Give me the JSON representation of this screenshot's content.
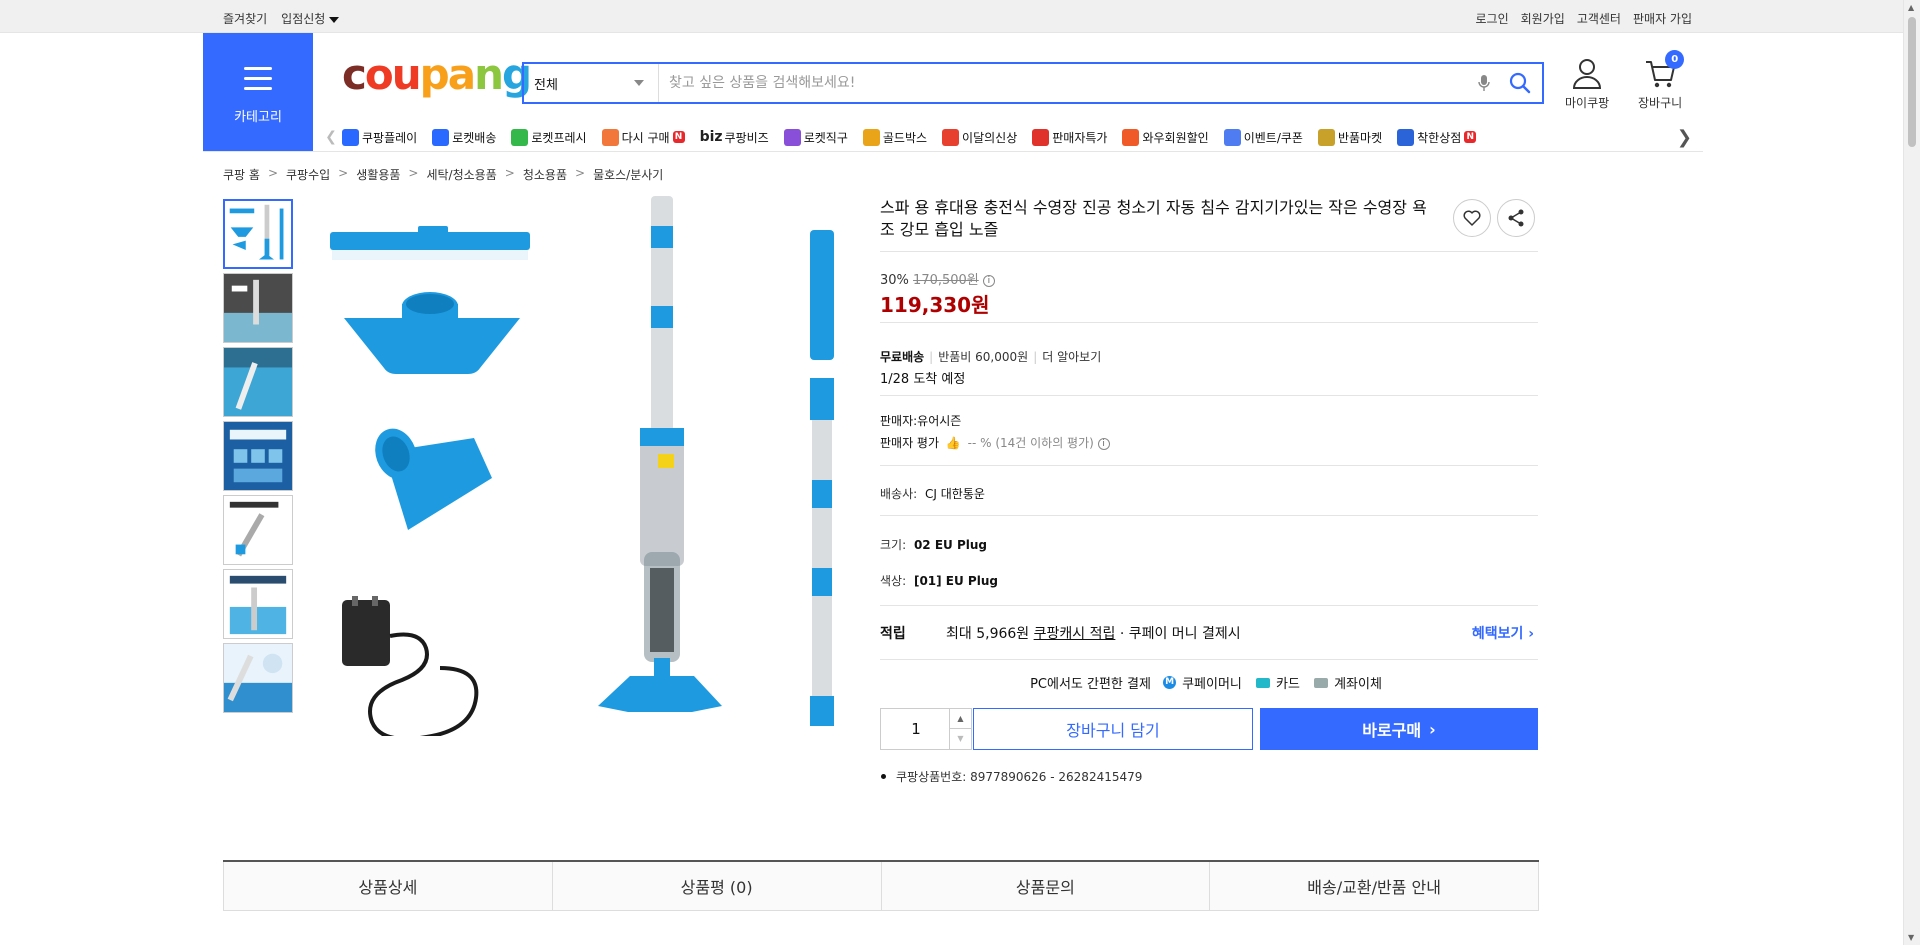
{
  "topbar": {
    "left": [
      {
        "label": "즐겨찾기"
      },
      {
        "label": "입점신청"
      }
    ],
    "right": [
      {
        "label": "로그인"
      },
      {
        "label": "회원가입"
      },
      {
        "label": "고객센터"
      },
      {
        "label": "판매자 가입"
      }
    ]
  },
  "header": {
    "category_label": "카테고리",
    "logo_text": [
      "c",
      "ou",
      "pa",
      "n",
      "g"
    ],
    "search_scope": "전체",
    "search_placeholder": "찾고 싶은 상품을 검색해보세요!",
    "mycoupang_label": "마이쿠팡",
    "cart_label": "장바구니",
    "cart_count": "0"
  },
  "shortcuts": [
    {
      "label": "쿠팡플레이",
      "icon": "play-icon",
      "color": "#2a69ff"
    },
    {
      "label": "로켓배송",
      "icon": "rocket-icon",
      "color": "#2a69ff"
    },
    {
      "label": "로켓프레시",
      "icon": "rocket-fresh-icon",
      "color": "#35b84a"
    },
    {
      "label": "다시 구매",
      "icon": "rebuy-icon",
      "color": "#f2773a",
      "new": "N"
    },
    {
      "label": "쿠팡비즈",
      "prefix": "biz",
      "icon": "biz-icon"
    },
    {
      "label": "로켓직구",
      "icon": "global-rocket-icon",
      "color": "#8a4fd8"
    },
    {
      "label": "골드박스",
      "icon": "goldbox-icon",
      "color": "#e9a41a"
    },
    {
      "label": "이달의신상",
      "icon": "new-arrival-icon",
      "color": "#e8402e"
    },
    {
      "label": "판매자특가",
      "icon": "seller-deal-icon",
      "color": "#e0322a"
    },
    {
      "label": "와우회원할인",
      "icon": "wow-icon",
      "color": "#f05a28"
    },
    {
      "label": "이벤트/쿠폰",
      "icon": "coupon-icon",
      "color": "#4f7cf0"
    },
    {
      "label": "반품마켓",
      "icon": "return-market-icon",
      "color": "#c8a12a"
    },
    {
      "label": "착한상점",
      "icon": "good-store-icon",
      "color": "#2a64d8",
      "new": "N"
    }
  ],
  "breadcrumb": [
    "쿠팡 홈",
    "쿠팡수입",
    "생활용품",
    "세탁/청소용품",
    "청소용품",
    "물호스/분사기"
  ],
  "product": {
    "title": "스파 용 휴대용 충전식 수영장 진공 청소기 자동 침수 감지기가있는 작은 수영장 욕조 강모 흡입 노즐",
    "discount_rate": "30%",
    "original_price": "170,500원",
    "price": "119,330원",
    "shipping_label": "무료배송",
    "return_fee": "반품비 60,000원",
    "learn_more": "더 알아보기",
    "arrival": "1/28 도착 예정",
    "seller": "판매자:유어시즌",
    "seller_rating_label": "판매자 평가",
    "seller_rating_value": "-- % (14건 이하의 평가)",
    "courier_label": "배송사:",
    "courier": "CJ 대한통운",
    "size_label": "크기:",
    "size": "02 EU Plug",
    "color_label": "색상:",
    "color": "[01] EU Plug",
    "reward_label": "적립",
    "reward_text_1": "최대 5,966원",
    "reward_text_2": "쿠팡캐시 적립",
    "reward_text_3": "· 쿠페이 머니 결제시",
    "reward_link": "혜택보기",
    "pay_intro": "PC에서도 간편한 결제",
    "pay_methods": [
      {
        "label": "쿠페이머니"
      },
      {
        "label": "카드"
      },
      {
        "label": "계좌이체"
      }
    ],
    "quantity": "1",
    "add_to_cart": "장바구니 담기",
    "buy_now": "바로구매",
    "product_number": "쿠팡상품번호: 8977890626 - 26282415479"
  },
  "tabs": [
    {
      "label": "상품상세"
    },
    {
      "label": "상품평 (0)"
    },
    {
      "label": "상품문의"
    },
    {
      "label": "배송/교환/반품 안내"
    }
  ],
  "colors": {
    "accent": "#346aff",
    "price": "#ae0000"
  }
}
